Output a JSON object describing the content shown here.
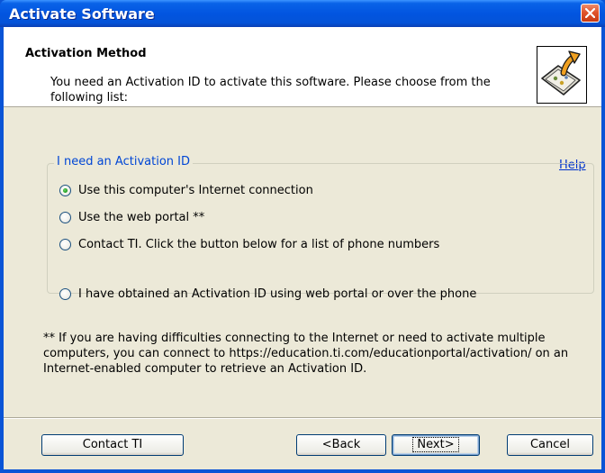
{
  "window": {
    "title": "Activate Software"
  },
  "header": {
    "title": "Activation Method",
    "description": "You need an Activation ID to activate this software. Please choose from the following list:",
    "icon": "activation-certificate-arrow-icon"
  },
  "help_link": "Help",
  "group": {
    "legend": "I need an Activation ID",
    "options": [
      {
        "label": "Use this computer's Internet connection",
        "checked": true
      },
      {
        "label": "Use the web portal **",
        "checked": false
      },
      {
        "label": "Contact TI. Click the button below for a list of phone numbers",
        "checked": false
      }
    ]
  },
  "obtained_option": {
    "label": "I have obtained an Activation ID using web portal or over the phone",
    "checked": false
  },
  "note": "** If you are having difficulties connecting to the Internet or need to activate multiple computers, you can connect to https://education.ti.com/educationportal/activation/ on an Internet-enabled computer to retrieve an Activation ID.",
  "buttons": {
    "contact": "Contact TI",
    "back": "<Back",
    "next": "Next>",
    "cancel": "Cancel"
  },
  "colors": {
    "titlebar": "#0255e0",
    "dialog_bg": "#ece9d8",
    "legend_text": "#0046d5",
    "link": "#0033cc"
  }
}
